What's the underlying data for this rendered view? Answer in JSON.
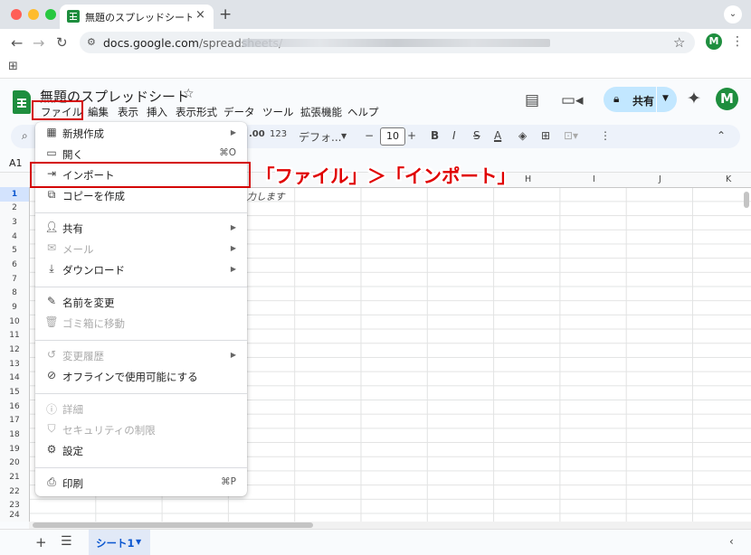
{
  "browser": {
    "tab_title": "無題のスプレッドシート - Google",
    "tab_close": "×",
    "new_tab": "+",
    "url_host": "docs.google.com",
    "url_path": "/spreadsheets/",
    "profile_initial": "M"
  },
  "header": {
    "title": "無題のスプレッドシート",
    "share_label": "共有",
    "avatar_initial": "M"
  },
  "menubar": [
    "ファイル",
    "編集",
    "表示",
    "挿入",
    "表示形式",
    "データ",
    "ツール",
    "拡張機能",
    "ヘルプ"
  ],
  "toolbar": {
    "decimal": ".00",
    "format_number": "123",
    "font": "デフォ...",
    "font_size": "10",
    "bold": "B",
    "italic": "I",
    "strike": "S",
    "text_color": "A"
  },
  "namebox": "A1",
  "grid": {
    "columns": [
      "H",
      "I",
      "J",
      "K"
    ],
    "rows": [
      "1",
      "2",
      "3",
      "4",
      "5",
      "6",
      "7",
      "8",
      "9",
      "10",
      "11",
      "12",
      "13",
      "14",
      "15",
      "16",
      "17",
      "18",
      "19",
      "20",
      "21",
      "22",
      "23",
      "24"
    ],
    "cell_hint": "入力します"
  },
  "sheets": {
    "active": "シート1"
  },
  "file_menu": {
    "items": [
      {
        "icon": "new-icon",
        "label": "新規作成",
        "shortcut": "",
        "submenu": true,
        "disabled": false
      },
      {
        "icon": "folder-icon",
        "label": "開く",
        "shortcut": "⌘O",
        "submenu": false,
        "disabled": false
      },
      {
        "icon": "import-icon",
        "label": "インポート",
        "shortcut": "",
        "submenu": false,
        "disabled": false
      },
      {
        "icon": "copy-icon",
        "label": "コピーを作成",
        "shortcut": "",
        "submenu": false,
        "disabled": false
      },
      {
        "icon": "share-icon",
        "label": "共有",
        "shortcut": "",
        "submenu": true,
        "disabled": false
      },
      {
        "icon": "mail-icon",
        "label": "メール",
        "shortcut": "",
        "submenu": true,
        "disabled": true
      },
      {
        "icon": "download-icon",
        "label": "ダウンロード",
        "shortcut": "",
        "submenu": true,
        "disabled": false
      },
      {
        "icon": "rename-icon",
        "label": "名前を変更",
        "shortcut": "",
        "submenu": false,
        "disabled": false
      },
      {
        "icon": "trash-icon",
        "label": "ゴミ箱に移動",
        "shortcut": "",
        "submenu": false,
        "disabled": true
      },
      {
        "icon": "history-icon",
        "label": "変更履歴",
        "shortcut": "",
        "submenu": true,
        "disabled": true
      },
      {
        "icon": "offline-icon",
        "label": "オフラインで使用可能にする",
        "shortcut": "",
        "submenu": false,
        "disabled": false
      },
      {
        "icon": "info-icon",
        "label": "詳細",
        "shortcut": "",
        "submenu": false,
        "disabled": true
      },
      {
        "icon": "security-icon",
        "label": "セキュリティの制限",
        "shortcut": "",
        "submenu": false,
        "disabled": true
      },
      {
        "icon": "settings-icon",
        "label": "設定",
        "shortcut": "",
        "submenu": false,
        "disabled": false
      },
      {
        "icon": "print-icon",
        "label": "印刷",
        "shortcut": "⌘P",
        "submenu": false,
        "disabled": false
      }
    ]
  },
  "annotation": {
    "callout": "「ファイル」＞「インポート」"
  },
  "colors": {
    "accent": "#1e8e3e",
    "highlight": "#d40000",
    "callout": "#e00000",
    "share_bg": "#c2e7ff"
  }
}
